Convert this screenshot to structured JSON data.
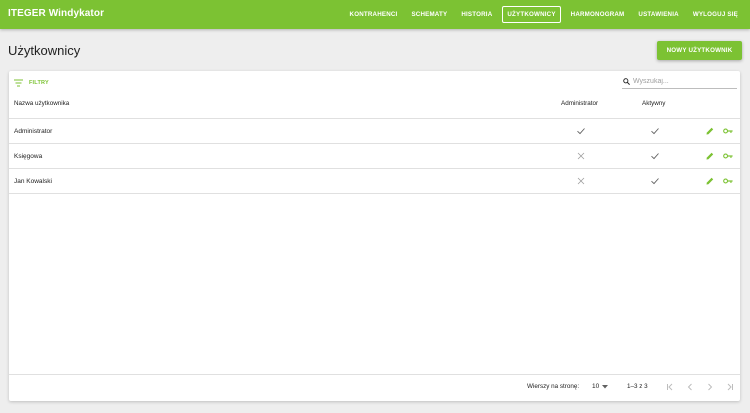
{
  "app": {
    "title": "ITEGER Windykator"
  },
  "nav": [
    {
      "label": "KONTRAHENCI",
      "active": false
    },
    {
      "label": "SCHEMATY",
      "active": false
    },
    {
      "label": "HISTORIA",
      "active": false
    },
    {
      "label": "UŻYTKOWNICY",
      "active": true
    },
    {
      "label": "HARMONOGRAM",
      "active": false
    },
    {
      "label": "USTAWIENIA",
      "active": false
    },
    {
      "label": "WYLOGUJ SIĘ",
      "active": false
    }
  ],
  "page": {
    "title": "Użytkownicy",
    "new_button": "NOWY UŻYTKOWNIK"
  },
  "toolbar": {
    "filter_label": "FILTRY",
    "filter_icon": "filter-list-icon",
    "search_placeholder": "Wyszukaj...",
    "search_value": "",
    "search_icon": "search-icon"
  },
  "table": {
    "columns": {
      "name": "Nazwa użytkownika",
      "admin": "Administrator",
      "active": "Aktywny"
    },
    "rows": [
      {
        "name": "Administrator",
        "admin": true,
        "active": true
      },
      {
        "name": "Księgowa",
        "admin": false,
        "active": true
      },
      {
        "name": "Jan Kowalski",
        "admin": false,
        "active": true
      }
    ],
    "row_actions": [
      "edit-icon",
      "key-icon"
    ]
  },
  "pagination": {
    "rows_per_page_label": "Wierszy na stronę:",
    "rows_per_page": "10",
    "range": "1–3 z 3",
    "buttons": [
      "first-page-icon",
      "prev-page-icon",
      "next-page-icon",
      "last-page-icon"
    ]
  },
  "colors": {
    "accent": "#7cc233",
    "background": "#eeeeee",
    "card": "#ffffff",
    "icon_gray": "#616161",
    "cross_gray": "#9e9e9e"
  }
}
